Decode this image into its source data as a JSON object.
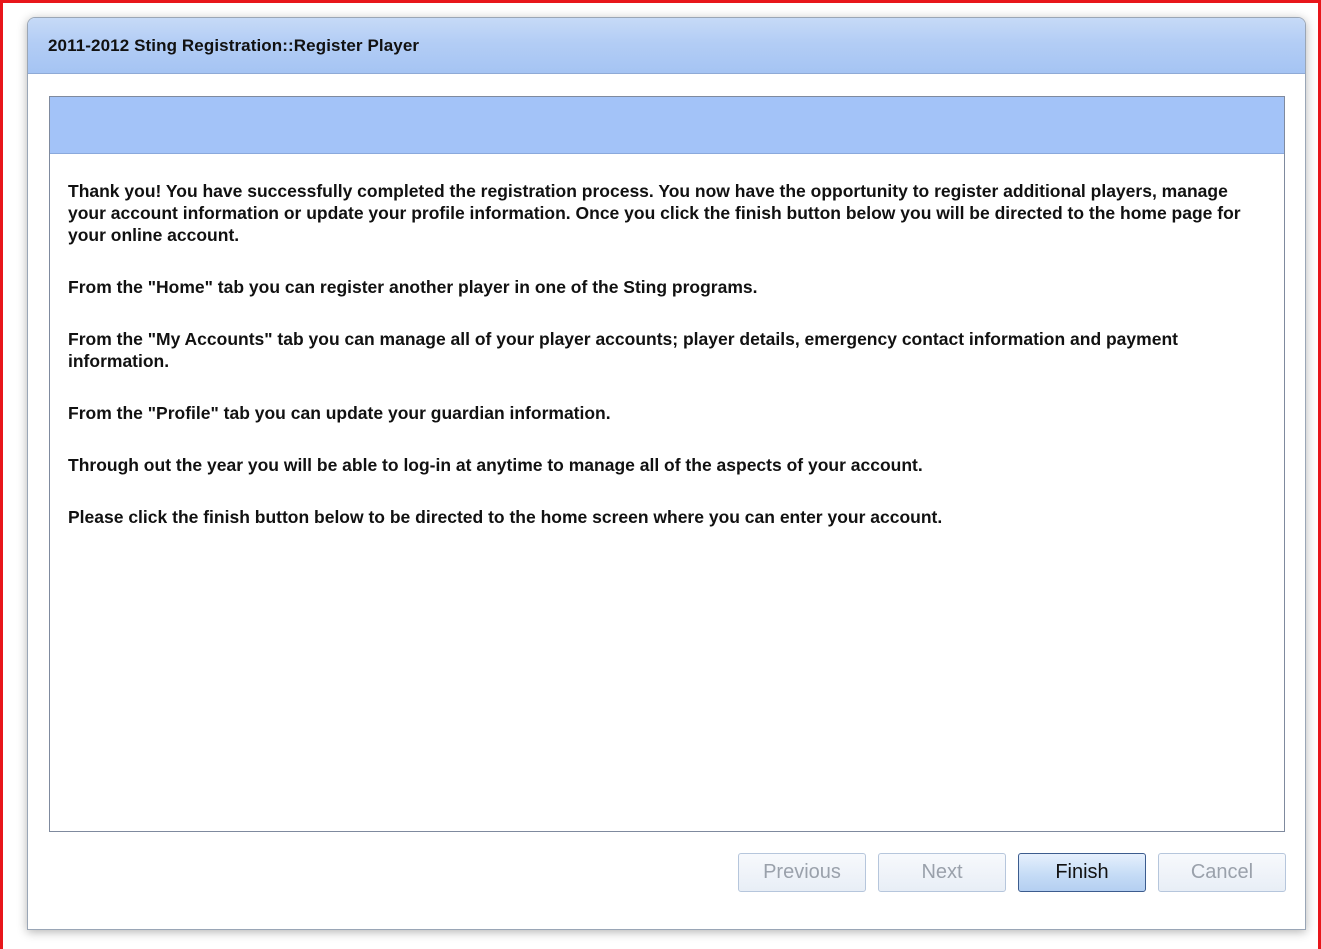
{
  "window": {
    "title": "2011-2012 Sting Registration::Register Player"
  },
  "content": {
    "paragraphs": [
      "Thank you! You have successfully completed the registration process. You now have the opportunity to register additional players, manage your account information or update your profile information. Once you click the finish button below you will be directed to the home page for your online account.",
      "From the \"Home\" tab you can register another player in one of the Sting programs.",
      "From the \"My Accounts\" tab you can manage all of your player accounts; player details, emergency contact information and payment information.",
      "From the \"Profile\" tab you can update your guardian information.",
      "Through out the year you will be able to log-in at anytime to manage all of the aspects of your account.",
      "Please click the finish button below to be directed to the home screen where you can enter your account."
    ]
  },
  "buttons": {
    "previous": "Previous",
    "next": "Next",
    "finish": "Finish",
    "cancel": "Cancel"
  },
  "colors": {
    "frame_border": "#e8161b",
    "titlebar": "#b3cdf5",
    "panel_header": "#a3c3f8"
  }
}
